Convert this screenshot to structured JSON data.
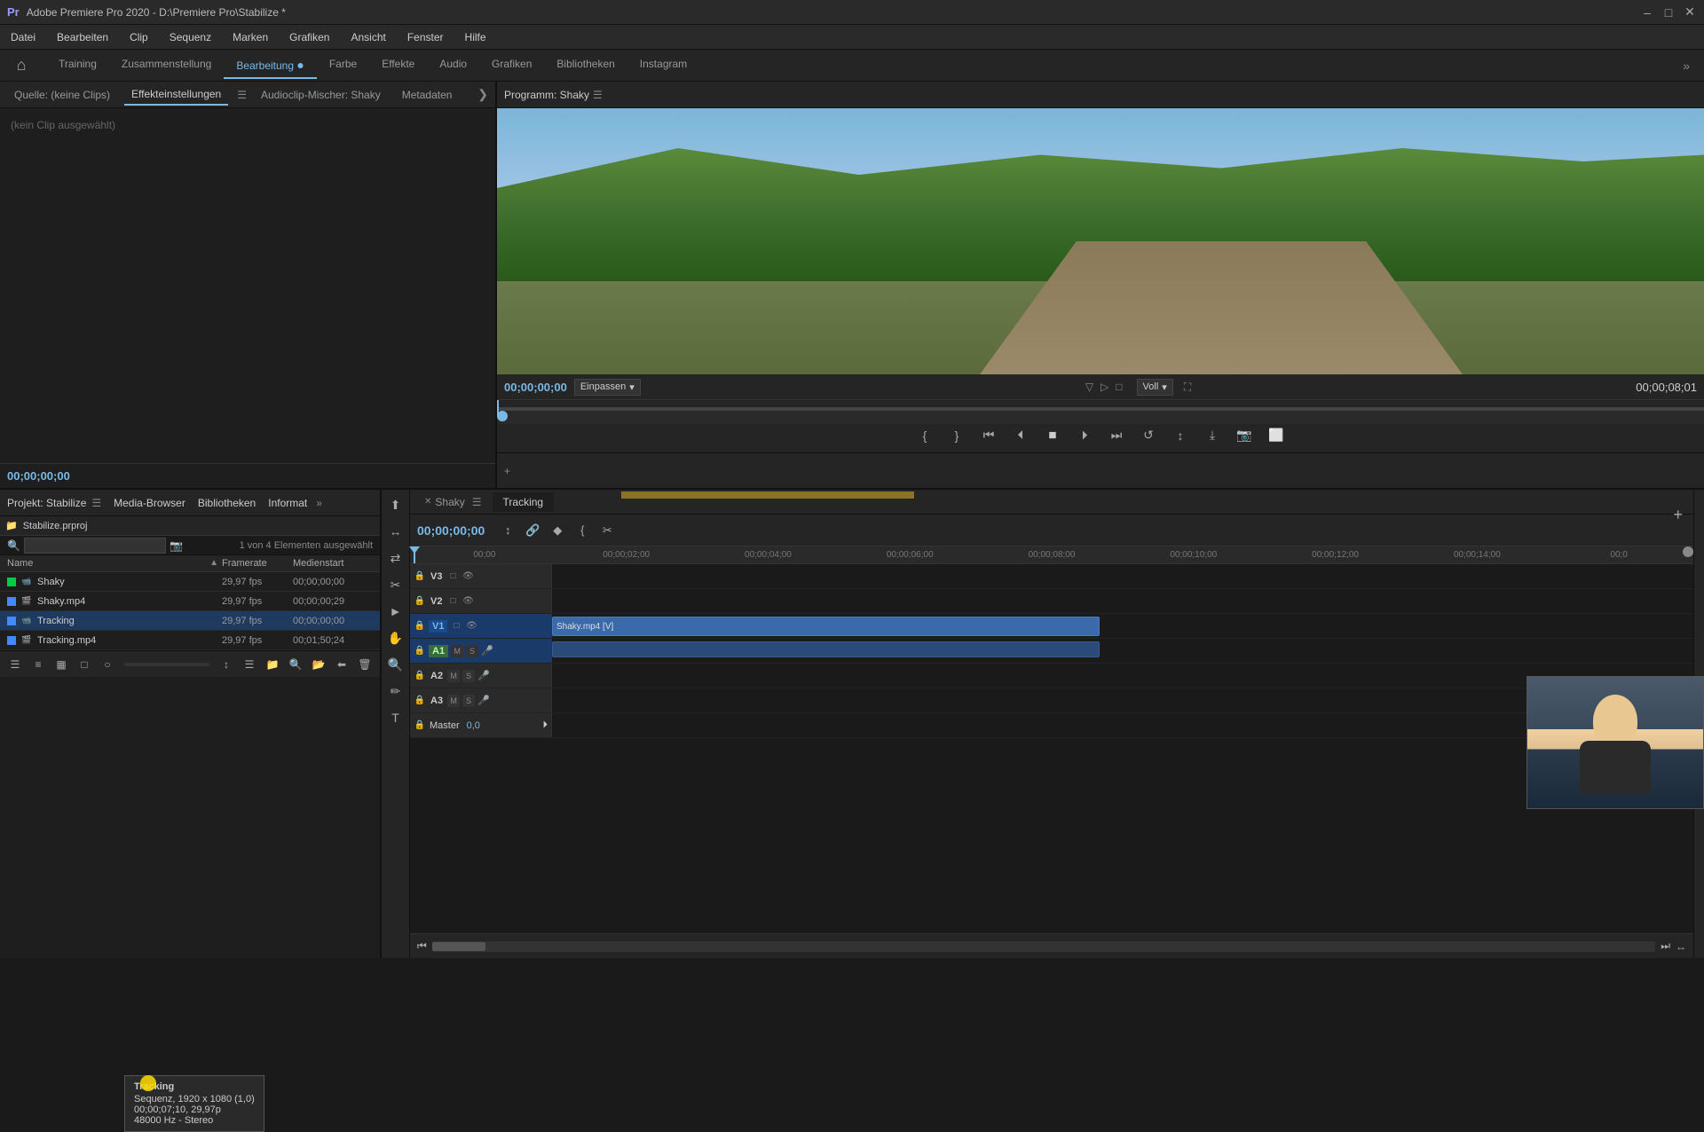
{
  "app": {
    "title": "Adobe Premiere Pro 2020 - D:\\Premiere Pro\\Stabilize *",
    "version": "Adobe Premiere Pro 2020"
  },
  "title_bar": {
    "title": "Adobe Premiere Pro 2020 - D:\\Premiere Pro\\Stabilize *"
  },
  "menu": {
    "items": [
      "Datei",
      "Bearbeiten",
      "Clip",
      "Sequenz",
      "Marken",
      "Grafiken",
      "Ansicht",
      "Fenster",
      "Hilfe"
    ]
  },
  "workspace_tabs": [
    {
      "label": "Training",
      "active": false
    },
    {
      "label": "Zusammenstellung",
      "active": false
    },
    {
      "label": "Bearbeitung",
      "active": true
    },
    {
      "label": "Farbe",
      "active": false
    },
    {
      "label": "Effekte",
      "active": false
    },
    {
      "label": "Audio",
      "active": false
    },
    {
      "label": "Grafiken",
      "active": false
    },
    {
      "label": "Bibliotheken",
      "active": false
    },
    {
      "label": "Instagram",
      "active": false
    }
  ],
  "panels": {
    "source_label": "Quelle: (keine Clips)",
    "effect_controls_label": "Effekteinstellungen",
    "audio_mixer_label": "Audioclip-Mischer: Shaky",
    "metadata_label": "Metadaten",
    "no_clip_label": "(kein Clip ausgewählt)",
    "program_monitor_label": "Programm: Shaky"
  },
  "monitor": {
    "timecode_left": "00;00;00;00",
    "fit_label": "Einpassen",
    "quality_label": "Voll",
    "timecode_right": "00;00;08;01"
  },
  "project": {
    "panel_label": "Projekt: Stabilize",
    "media_browser_label": "Media-Browser",
    "libraries_label": "Bibliotheken",
    "info_label": "Informat",
    "project_file": "Stabilize.prproj",
    "selection_info": "1 von 4 Elementen ausgewählt",
    "columns": {
      "name": "Name",
      "framerate": "Framerate",
      "media_start": "Medienstart"
    },
    "items": [
      {
        "color": "#00cc44",
        "type": "sequence",
        "name": "Shaky",
        "framerate": "29,97 fps",
        "media_start": "00;00;00;00"
      },
      {
        "color": "#4488ff",
        "type": "video",
        "name": "Shaky.mp4",
        "framerate": "29,97 fps",
        "media_start": "00;00;00;29"
      },
      {
        "color": "#4488ff",
        "type": "sequence",
        "name": "Tracking",
        "framerate": "29,97 fps",
        "media_start": "00;00;00;00",
        "selected": true
      },
      {
        "color": "#4488ff",
        "type": "video",
        "name": "Tracking.mp4",
        "framerate": "29,97 fps",
        "media_start": "00;01;50;24"
      }
    ]
  },
  "tooltip": {
    "title": "Tracking",
    "line1": "Sequenz, 1920 x 1080 (1,0)",
    "line2": "00;00;07;10, 29,97p",
    "line3": "48000 Hz - Stereo"
  },
  "timeline": {
    "timecode": "00;00;00;00",
    "tabs": [
      {
        "label": "Shaky",
        "active": false
      },
      {
        "label": "Tracking",
        "active": true
      }
    ],
    "ruler_marks": [
      "00;00",
      ";00;02;00",
      "00;00;04;00",
      "00;00;06;00",
      "00;00;08;00",
      "00;00;10;00",
      "00;00;12;00",
      "00;00;14;00",
      "00;0"
    ],
    "tracks": [
      {
        "id": "V3",
        "type": "video",
        "label": "V3",
        "active": false,
        "clips": []
      },
      {
        "id": "V2",
        "type": "video",
        "label": "V2",
        "active": false,
        "clips": []
      },
      {
        "id": "V1",
        "type": "video",
        "label": "V1",
        "active": true,
        "clips": [
          {
            "name": "Shaky.mp4 [V]",
            "start_pct": 0,
            "width_pct": 48
          }
        ]
      },
      {
        "id": "A1",
        "type": "audio",
        "label": "A1",
        "active": true,
        "clips": [
          {
            "name": "",
            "start_pct": 0,
            "width_pct": 48
          }
        ]
      },
      {
        "id": "A2",
        "type": "audio",
        "label": "A2",
        "active": false,
        "clips": []
      },
      {
        "id": "A3",
        "type": "audio",
        "label": "A3",
        "active": false,
        "clips": []
      }
    ],
    "master_label": "Master",
    "master_value": "0,0"
  },
  "controls": {
    "buttons": [
      "mark_in",
      "mark_out",
      "step_back",
      "play_back",
      "play",
      "play_forward",
      "step_forward",
      "loop",
      "camera",
      "safe_margins"
    ]
  }
}
